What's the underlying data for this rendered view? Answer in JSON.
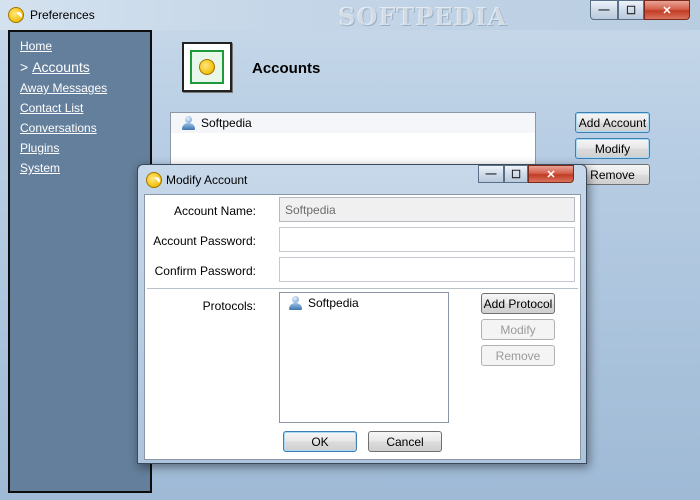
{
  "window": {
    "title": "Preferences",
    "watermark": "SOFTPEDIA",
    "controls": {
      "minimize": "—",
      "maximize": "☐",
      "close": "✕"
    }
  },
  "sidebar": {
    "items": [
      {
        "label": "Home"
      },
      {
        "label": "Accounts",
        "prefix": ">",
        "active": true
      },
      {
        "label": "Away Messages"
      },
      {
        "label": "Contact List"
      },
      {
        "label": "Conversations"
      },
      {
        "label": "Plugins"
      },
      {
        "label": "System"
      }
    ]
  },
  "accounts": {
    "title": "Accounts",
    "list": [
      {
        "name": "Softpedia",
        "icon": "user-icon"
      }
    ],
    "buttons": {
      "add": "Add Account",
      "modify": "Modify",
      "remove": "Remove"
    }
  },
  "dialog": {
    "title": "Modify Account",
    "controls": {
      "minimize": "—",
      "maximize": "☐",
      "close": "✕"
    },
    "fields": {
      "account_name": {
        "label": "Account Name:",
        "value": "Softpedia"
      },
      "account_password": {
        "label": "Account Password:",
        "value": ""
      },
      "confirm_password": {
        "label": "Confirm Password:",
        "value": ""
      }
    },
    "protocols": {
      "label": "Protocols:",
      "items": [
        {
          "name": "Softpedia",
          "icon": "user-icon"
        }
      ],
      "buttons": {
        "add": "Add Protocol",
        "modify": "Modify",
        "remove": "Remove"
      }
    },
    "ok": "OK",
    "cancel": "Cancel"
  },
  "colors": {
    "sidebar_bg": "#647f9b",
    "window_bg": "#b7cde3",
    "close_button": "#c23c24",
    "focus_border": "#3c7fb1"
  }
}
